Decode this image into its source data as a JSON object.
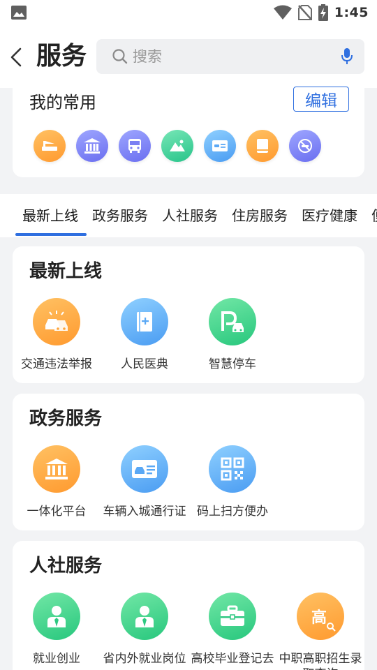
{
  "status_bar": {
    "time": "1:45"
  },
  "header": {
    "title": "服务",
    "search_placeholder": "搜索"
  },
  "favorites": {
    "title": "我的常用",
    "edit_label": "编辑",
    "icons": [
      "highway-icon",
      "government-building-icon",
      "bus-icon",
      "landscape-icon",
      "vehicle-permit-icon",
      "book-icon",
      "no-smoking-icon"
    ]
  },
  "tabs": [
    "最新上线",
    "政务服务",
    "人社服务",
    "住房服务",
    "医疗健康",
    "便"
  ],
  "sections": [
    {
      "title": "最新上线",
      "items": [
        {
          "label": "交通违法举报",
          "icon": "traffic-violation-icon",
          "color": "orange"
        },
        {
          "label": "人民医典",
          "icon": "medical-book-icon",
          "color": "blue"
        },
        {
          "label": "智慧停车",
          "icon": "parking-icon",
          "color": "green"
        }
      ]
    },
    {
      "title": "政务服务",
      "items": [
        {
          "label": "一体化平台",
          "icon": "government-building-icon",
          "color": "orange"
        },
        {
          "label": "车辆入城通行证",
          "icon": "vehicle-permit-icon",
          "color": "blue"
        },
        {
          "label": "码上扫方便办",
          "icon": "qr-code-icon",
          "color": "blue"
        }
      ]
    },
    {
      "title": "人社服务",
      "items": [
        {
          "label": "就业创业",
          "icon": "employee-icon",
          "color": "green"
        },
        {
          "label": "省内外就业岗位",
          "icon": "employee-icon",
          "color": "green"
        },
        {
          "label": "高校毕业登记去",
          "icon": "briefcase-icon",
          "color": "green"
        },
        {
          "label": "中职高职招生录取查询",
          "icon": "education-search-icon",
          "color": "orange",
          "badge": "高"
        }
      ]
    }
  ],
  "colors": {
    "accent": "#2f6fe0",
    "background": "#f2f3f5"
  }
}
